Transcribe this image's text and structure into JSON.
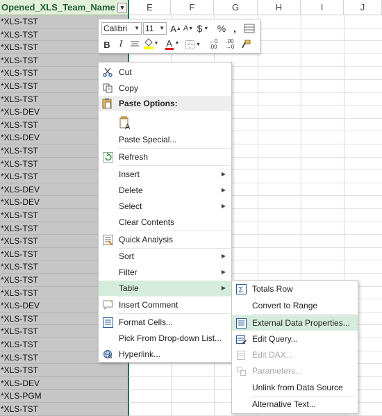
{
  "sheet": {
    "column_d_header": "Opened_XLS_Team_Name",
    "columns": [
      "E",
      "F",
      "G",
      "H",
      "I",
      "J"
    ],
    "rows": [
      "*XLS-TST",
      "*XLS-TST",
      "*XLS-TST",
      "*XLS-TST",
      "*XLS-TST",
      "*XLS-TST",
      "*XLS-TST",
      "*XLS-DEV",
      "*XLS-TST",
      "*XLS-DEV",
      "*XLS-TST",
      "*XLS-TST",
      "*XLS-TST",
      "*XLS-DEV",
      "*XLS-DEV",
      "*XLS-TST",
      "*XLS-TST",
      "*XLS-TST",
      "*XLS-TST",
      "*XLS-TST",
      "*XLS-TST",
      "*XLS-TST",
      "*XLS-DEV",
      "*XLS-TST",
      "*XLS-TST",
      "*XLS-TST",
      "*XLS-TST",
      "*XLS-TST",
      "*XLS-DEV",
      "*XLS-PGM",
      "*XLS-TST"
    ]
  },
  "mini_toolbar": {
    "font": "Calibri",
    "size": "11",
    "grow_font": "A",
    "shrink_font": "A",
    "currency": "$",
    "percent": "%",
    "comma": ",",
    "bold": "B",
    "italic": "I",
    "font_color": "A",
    "inc_decimal": "+.0 .00",
    "dec_decimal": ".00 →.0"
  },
  "context_menu": {
    "cut": "Cut",
    "copy": "Copy",
    "paste_options": "Paste Options:",
    "paste_special": "Paste Special...",
    "refresh": "Refresh",
    "insert": "Insert",
    "delete": "Delete",
    "select": "Select",
    "clear_contents": "Clear Contents",
    "quick_analysis": "Quick Analysis",
    "sort": "Sort",
    "filter": "Filter",
    "table": "Table",
    "insert_comment": "Insert Comment",
    "format_cells": "Format Cells...",
    "pick_from_list": "Pick From Drop-down List...",
    "hyperlink": "Hyperlink..."
  },
  "table_submenu": {
    "totals_row": "Totals Row",
    "convert_to_range": "Convert to Range",
    "external_data_properties": "External Data Properties...",
    "edit_query": "Edit Query...",
    "edit_dax": "Edit DAX...",
    "parameters": "Parameters...",
    "unlink": "Unlink from Data Source",
    "alt_text": "Alternative Text..."
  },
  "colors": {
    "excel_green": "#217346",
    "menu_highlight": "#d5ebdc",
    "selected_cells": "#c6c6c6",
    "font_color_bar": "#e02020",
    "fill_color_bar": "#ffff00"
  }
}
